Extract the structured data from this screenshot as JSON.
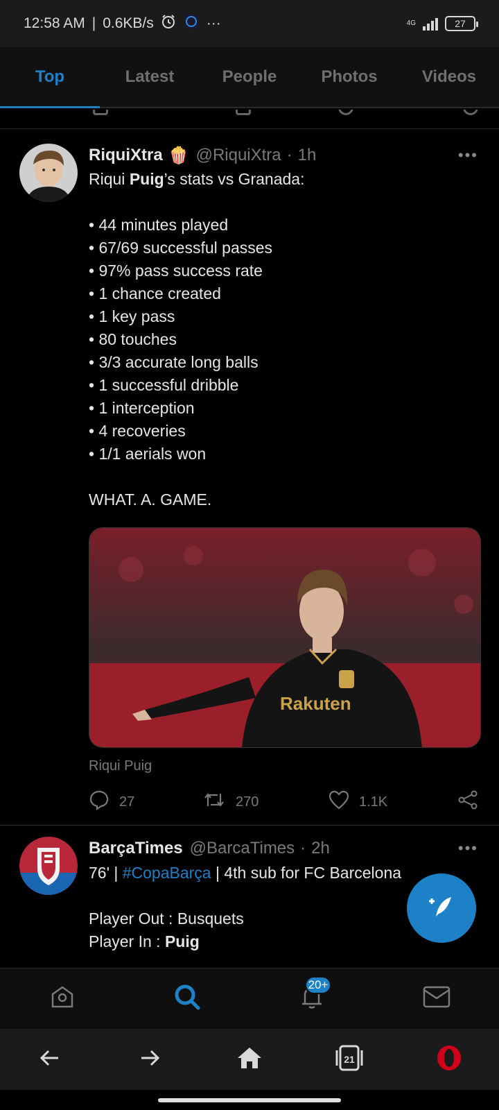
{
  "status_bar": {
    "time": "12:58 AM",
    "separator": "|",
    "speed": "0.6KB/s",
    "more": "···",
    "battery": "27",
    "network": "4G"
  },
  "tabs": [
    {
      "label": "Top",
      "active": true
    },
    {
      "label": "Latest",
      "active": false
    },
    {
      "label": "People",
      "active": false
    },
    {
      "label": "Photos",
      "active": false
    },
    {
      "label": "Videos",
      "active": false
    }
  ],
  "tweets": [
    {
      "name": "RiquiXtra",
      "name_emoji": "🍿",
      "handle": "@RiquiXtra",
      "time": "1h",
      "more": "•••",
      "text_lines": [
        {
          "before": "Riqui ",
          "bold": "Puig",
          "after": "’s stats vs Granada:"
        },
        "",
        "• 44 minutes played",
        "• 67/69 successful passes",
        "• 97% pass success rate",
        "• 1 chance created",
        "• 1 key pass",
        "• 80 touches",
        "• 3/3 accurate long balls",
        "• 1 successful dribble",
        "• 1 interception",
        "• 4 recoveries",
        "• 1/1 aerials won",
        "",
        "WHAT. A. GAME."
      ],
      "media_caption": "Riqui Puig",
      "media_jersey_text": "Rakuten",
      "reply_count": "27",
      "retweet_count": "270",
      "like_count": "1.1K"
    },
    {
      "name": "BarçaTimes",
      "handle": "@BarcaTimes",
      "time": "2h",
      "more": "•••",
      "line1_before": "76' | ",
      "line1_hashtag": "#CopaBarça",
      "line1_after": " | 4th sub for FC Barcelona",
      "line3": "Player Out : Busquets",
      "line4_before": "Player In : ",
      "line4_bold": "Puig"
    }
  ],
  "bottom_nav": {
    "notifications_badge": "20+"
  },
  "browser_bar": {
    "tabs_count": "21"
  },
  "colors": {
    "accent": "#1d81c8",
    "background": "#000000",
    "muted": "#7a7a7a",
    "opera_red": "#d0021b"
  }
}
